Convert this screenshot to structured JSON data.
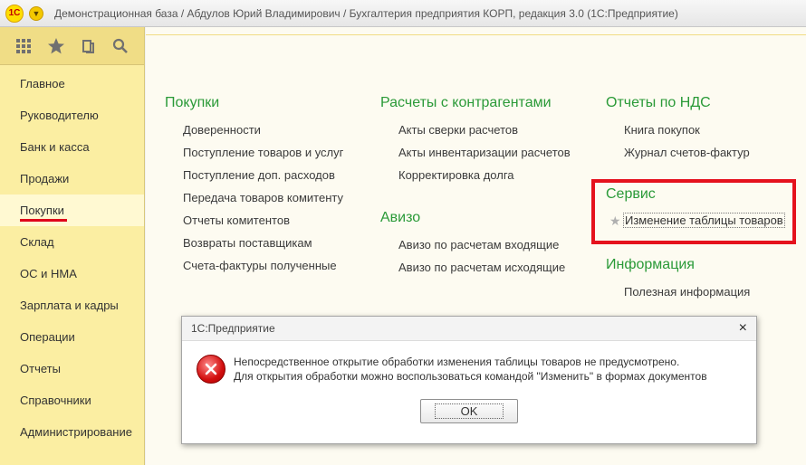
{
  "window": {
    "logo_text": "1С",
    "title": "Демонстрационная база / Абдулов Юрий Владимирович / Бухгалтерия предприятия КОРП, редакция 3.0  (1С:Предприятие)"
  },
  "sidebar": {
    "tools": [
      "apps-grid-icon",
      "favorites-star-icon",
      "history-icon",
      "search-icon"
    ],
    "items": [
      {
        "label": "Главное"
      },
      {
        "label": "Руководителю"
      },
      {
        "label": "Банк и касса"
      },
      {
        "label": "Продажи"
      },
      {
        "label": "Покупки",
        "active": true
      },
      {
        "label": "Склад"
      },
      {
        "label": "ОС и НМА"
      },
      {
        "label": "Зарплата и кадры"
      },
      {
        "label": "Операции"
      },
      {
        "label": "Отчеты"
      },
      {
        "label": "Справочники"
      },
      {
        "label": "Администрирование"
      }
    ]
  },
  "sections": {
    "purchases": {
      "title": "Покупки",
      "links": [
        "Доверенности",
        "Поступление товаров и услуг",
        "Поступление доп. расходов",
        "Передача товаров комитенту",
        "Отчеты комитентов",
        "Возвраты поставщикам",
        "Счета-фактуры полученные"
      ]
    },
    "settlements": {
      "title": "Расчеты с контрагентами",
      "links": [
        "Акты сверки расчетов",
        "Акты инвентаризации расчетов",
        "Корректировка долга"
      ]
    },
    "aviso": {
      "title": "Авизо",
      "links": [
        "Авизо по расчетам входящие",
        "Авизо по расчетам исходящие"
      ]
    },
    "vat_reports": {
      "title": "Отчеты по НДС",
      "links": [
        "Книга покупок",
        "Журнал счетов-фактур"
      ]
    },
    "service": {
      "title": "Сервис",
      "links": [
        "Изменение таблицы товаров"
      ]
    },
    "info": {
      "title": "Информация",
      "links": [
        "Полезная информация"
      ]
    }
  },
  "dialog": {
    "title": "1С:Предприятие",
    "close": "×",
    "message_line1": "Непосредственное открытие обработки изменения таблицы товаров не предусмотрено.",
    "message_line2": "Для открытия обработки можно воспользоваться командой \"Изменить\" в формах документов",
    "ok_label": "OK"
  },
  "colors": {
    "sidebar_bg": "#fbeea2",
    "section_title": "#2a9a38",
    "highlight_border": "#e5121d",
    "active_underline": "#e0001a"
  }
}
